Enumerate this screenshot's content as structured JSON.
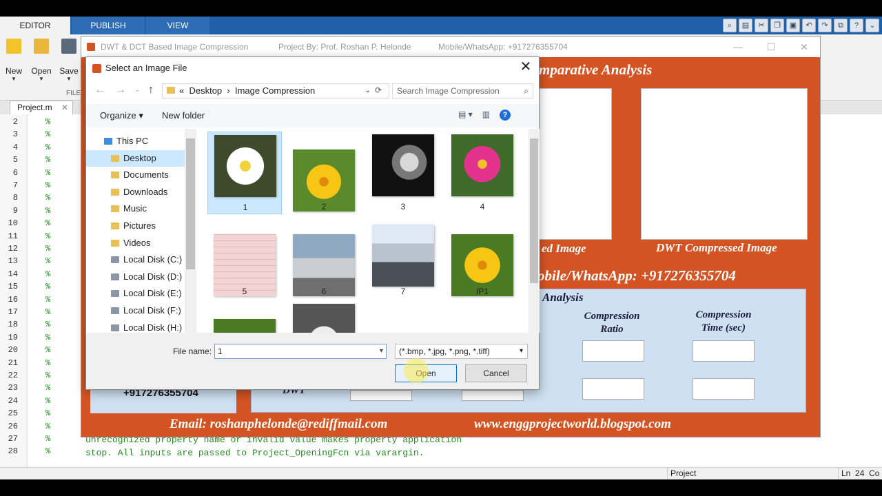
{
  "matlab": {
    "tabs": [
      "EDITOR",
      "PUBLISH",
      "VIEW"
    ],
    "tools": [
      {
        "label": "New",
        "icon": "new-plus-icon"
      },
      {
        "label": "Open",
        "icon": "folder-open-icon"
      },
      {
        "label": "Save",
        "icon": "floppy-save-icon"
      }
    ],
    "section_label": "FILE",
    "file_tab": "Project.m",
    "line_numbers": [
      "2",
      "3",
      "4",
      "5",
      "6",
      "7",
      "8",
      "9",
      "10",
      "11",
      "12",
      "13",
      "14",
      "15",
      "16",
      "17",
      "18",
      "19",
      "20",
      "21",
      "22",
      "23",
      "24",
      "25",
      "26",
      "27",
      "28"
    ],
    "comment_marker": "%",
    "code_lines": [
      "unrecognized property name or invalid value makes property application",
      "stop.  All inputs are passed to Project_OpeningFcn via varargin."
    ],
    "status": {
      "project": "Project",
      "ln_label": "Ln",
      "ln_value": "24",
      "col": "Co"
    }
  },
  "gui": {
    "title": "DWT & DCT Based Image Compression",
    "author": "Project By: Prof. Roshan P. Helonde",
    "phone": "Mobile/WhatsApp: +917276355704",
    "heading": "mparative Analysis",
    "caption_left": "ed Image",
    "caption_right": "DWT Compressed Image",
    "contact_line": "obile/WhatsApp: +917276355704",
    "analysis_title": "Analysis",
    "col1": [
      "Compression",
      "Ratio"
    ],
    "col2": [
      "Compression",
      "Time (sec)"
    ],
    "left_phone": "+917276355704",
    "row_label": "DWT",
    "email": "Email: roshanphelonde@rediffmail.com",
    "website": "www.enggprojectworld.blogspot.com"
  },
  "dialog": {
    "title": "Select an Image File",
    "breadcrumb": [
      "Desktop",
      "Image Compression"
    ],
    "search_placeholder": "Search Image Compression",
    "organize": "Organize",
    "new_folder": "New folder",
    "tree": [
      {
        "label": "This PC",
        "icon": "pc-icon",
        "selected": false
      },
      {
        "label": "Desktop",
        "icon": "folder-icon",
        "selected": true
      },
      {
        "label": "Documents",
        "icon": "folder-icon",
        "selected": false
      },
      {
        "label": "Downloads",
        "icon": "folder-icon",
        "selected": false
      },
      {
        "label": "Music",
        "icon": "folder-icon",
        "selected": false
      },
      {
        "label": "Pictures",
        "icon": "folder-icon",
        "selected": false
      },
      {
        "label": "Videos",
        "icon": "folder-icon",
        "selected": false
      },
      {
        "label": "Local Disk (C:)",
        "icon": "disk-icon",
        "selected": false
      },
      {
        "label": "Local Disk (D:)",
        "icon": "disk-icon",
        "selected": false
      },
      {
        "label": "Local Disk (E:)",
        "icon": "disk-icon",
        "selected": false
      },
      {
        "label": "Local Disk (F:)",
        "icon": "disk-icon",
        "selected": false
      },
      {
        "label": "Local Disk (H:)",
        "icon": "disk-icon",
        "selected": false
      }
    ],
    "files": [
      {
        "label": "1",
        "kind": "white daisy",
        "selected": true
      },
      {
        "label": "2",
        "kind": "yellow flower"
      },
      {
        "label": "3",
        "kind": "leopard"
      },
      {
        "label": "4",
        "kind": "pink flower"
      },
      {
        "label": "5",
        "kind": "ecg"
      },
      {
        "label": "6",
        "kind": "car"
      },
      {
        "label": "7",
        "kind": "motorbike"
      },
      {
        "label": "IP1",
        "kind": "yellow flower"
      }
    ],
    "file_name_label": "File name:",
    "file_name_value": "1",
    "file_type": "(*.bmp, *.jpg, *.png, *.tiff)",
    "open": "Open",
    "cancel": "Cancel"
  }
}
